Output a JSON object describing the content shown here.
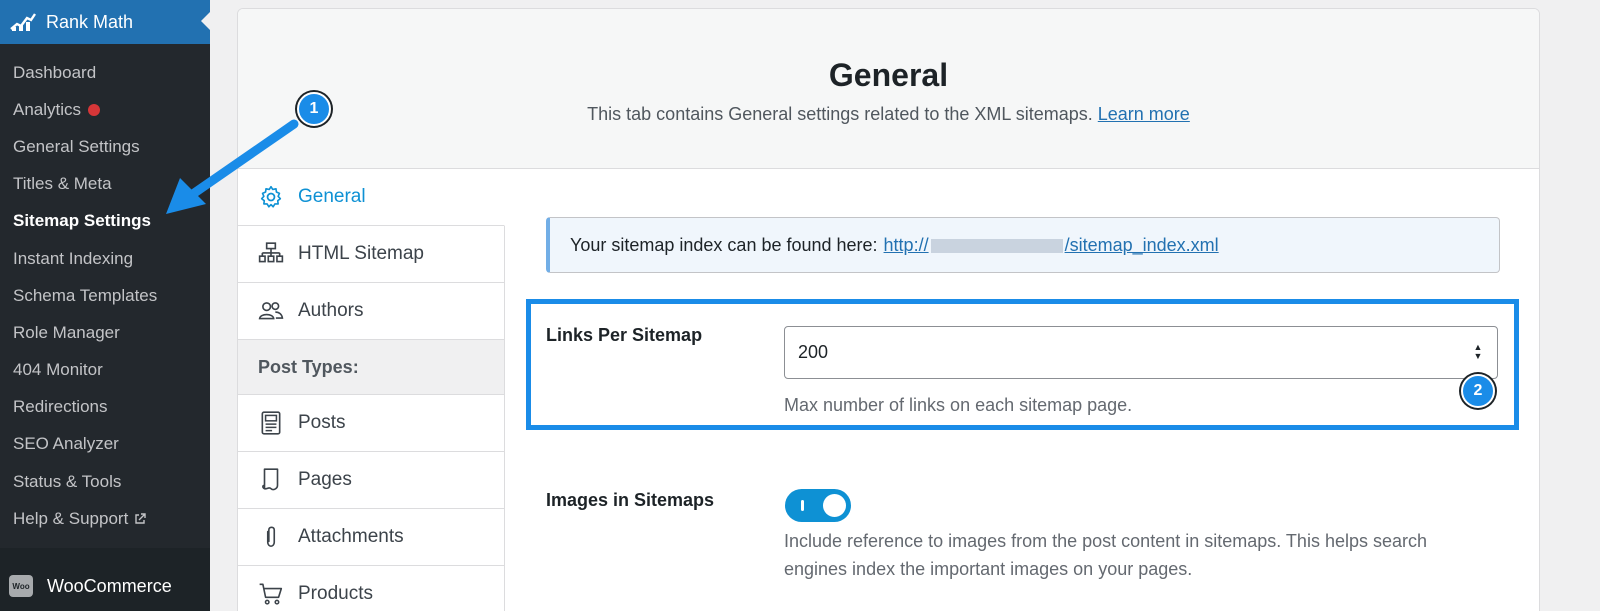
{
  "sidebar": {
    "brand": "Rank Math",
    "items": [
      {
        "label": "Dashboard"
      },
      {
        "label": "Analytics"
      },
      {
        "label": "General Settings"
      },
      {
        "label": "Titles & Meta"
      },
      {
        "label": "Sitemap Settings"
      },
      {
        "label": "Instant Indexing"
      },
      {
        "label": "Schema Templates"
      },
      {
        "label": "Role Manager"
      },
      {
        "label": "404 Monitor"
      },
      {
        "label": "Redirections"
      },
      {
        "label": "SEO Analyzer"
      },
      {
        "label": "Status & Tools"
      },
      {
        "label": "Help & Support"
      }
    ],
    "woocommerce": {
      "logo_text": "Woo",
      "label": "WooCommerce"
    }
  },
  "header": {
    "title": "General",
    "description": "This tab contains General settings related to the XML sitemaps.",
    "learn_more": "Learn more"
  },
  "tabs": {
    "items": [
      {
        "label": "General",
        "icon": "gear-icon"
      },
      {
        "label": "HTML Sitemap",
        "icon": "sitemap-icon"
      },
      {
        "label": "Authors",
        "icon": "users-icon"
      }
    ],
    "section_label": "Post Types:",
    "post_types": [
      {
        "label": "Posts",
        "icon": "document-icon"
      },
      {
        "label": "Pages",
        "icon": "page-icon"
      },
      {
        "label": "Attachments",
        "icon": "paperclip-icon"
      },
      {
        "label": "Products",
        "icon": "cart-icon"
      }
    ]
  },
  "notice": {
    "text": "Your sitemap index can be found here:",
    "link_prefix": "http://",
    "link_suffix": "/sitemap_index.xml"
  },
  "links_per_sitemap": {
    "label": "Links Per Sitemap",
    "value": "200",
    "help": "Max number of links on each sitemap page."
  },
  "images_in_sitemaps": {
    "label": "Images in Sitemaps",
    "enabled": true,
    "help_line1": "Include reference to images from the post content in sitemaps. This helps search",
    "help_line2": "engines index the important images on your pages."
  },
  "annotations": {
    "step1": "1",
    "step2": "2"
  },
  "colors": {
    "accent": "#0e91d4",
    "sidebar_bg": "#23282d",
    "annotation": "#1a8ce8"
  }
}
